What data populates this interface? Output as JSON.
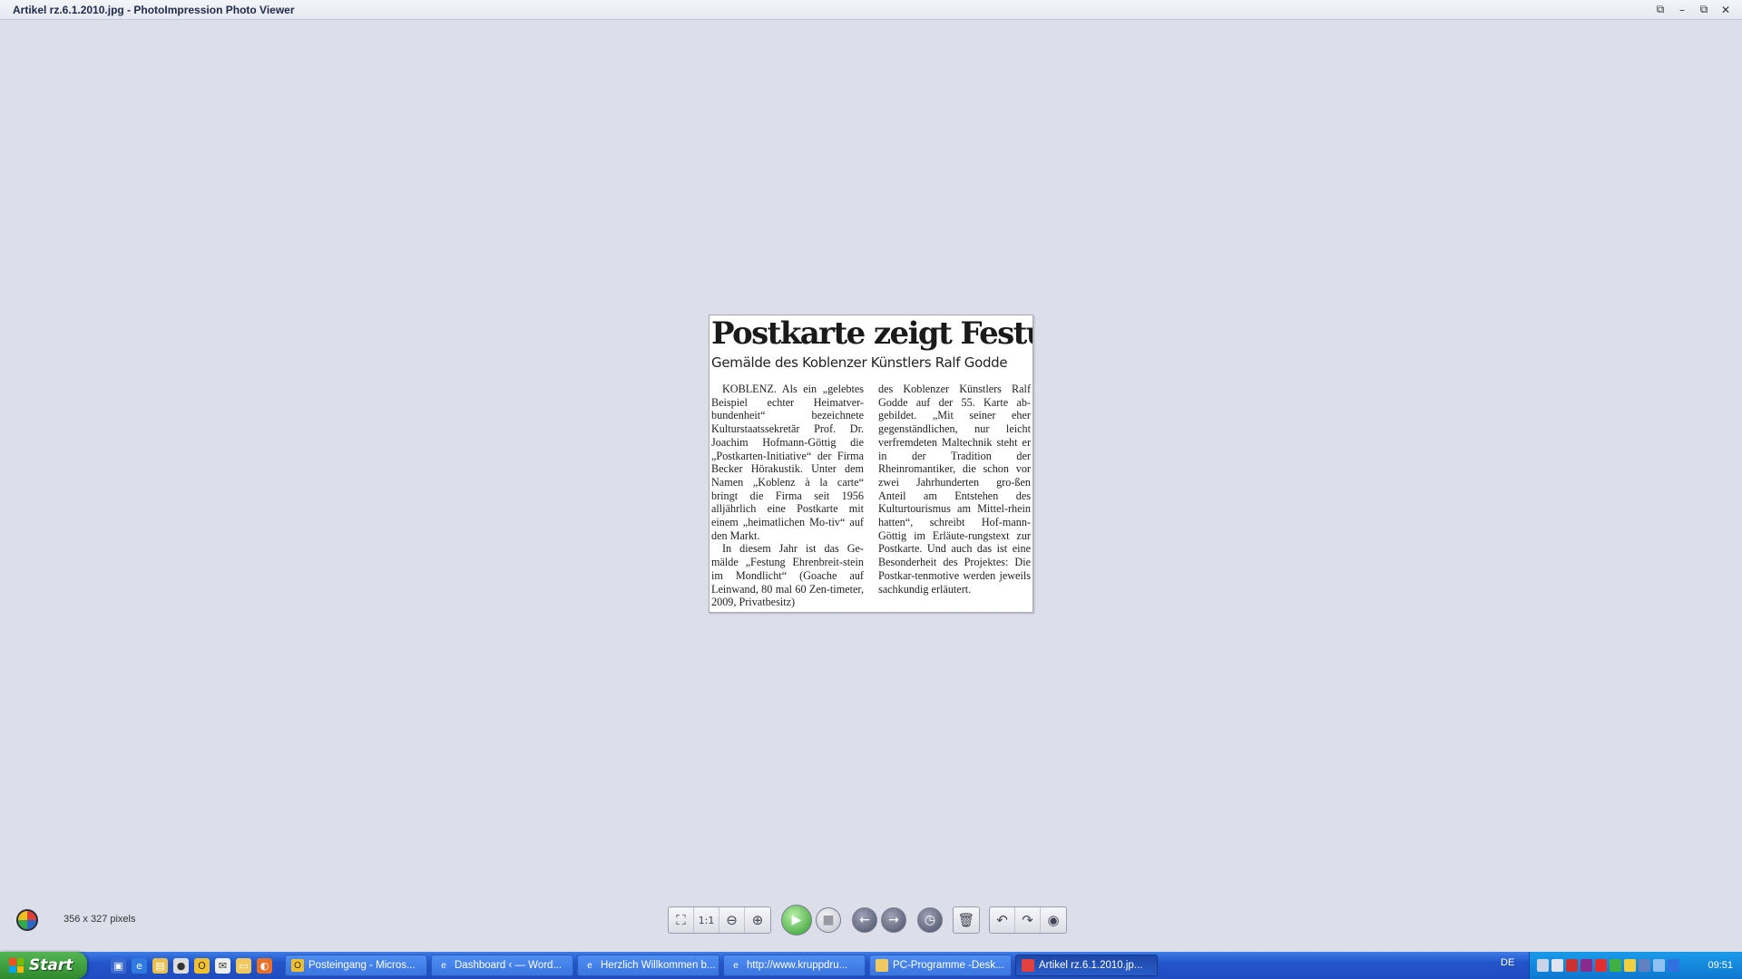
{
  "window": {
    "title": "Artikel rz.6.1.2010.jpg - PhotoImpression Photo Viewer",
    "buttons": [
      "⧉",
      "–",
      "⧉",
      "✕"
    ]
  },
  "article": {
    "headline": "Postkarte zeigt Festung",
    "subhead": "Gemälde des Koblenzer Künstlers Ralf Godde",
    "col1_p1": "KOBLENZ. Als ein „gelebtes Beispiel echter Heimatver-bundenheit“ bezeichnete Kulturstaatssekretär Prof. Dr. Joachim Hofmann-Göttig die „Postkarten-Initiative“ der Firma Becker Hörakustik. Unter dem Namen „Koblenz à la carte“ bringt die Firma seit 1956 alljährlich eine Postkarte mit einem „heimatlichen Mo-tiv“ auf den Markt.",
    "col1_p2": "In diesem Jahr ist das Ge-mälde „Festung Ehrenbreit-stein im Mondlicht“ (Goache auf Leinwand, 80 mal 60 Zen-timeter, 2009, Privatbesitz)",
    "col2": "des Koblenzer Künstlers Ralf Godde auf der 55. Karte ab-gebildet. „Mit seiner eher gegenständlichen, nur leicht verfremdeten Maltechnik steht er in der Tradition der Rheinromantiker, die schon vor zwei Jahrhunderten gro-ßen Anteil am Entstehen des Kulturtourismus am Mittel-rhein hatten“, schreibt Hof-mann-Göttig im Erläute-rungstext zur Postkarte. Und auch das ist eine Besonderheit des Projektes: Die Postkar-tenmotive werden jeweils sachkundig erläutert."
  },
  "status": {
    "dimensions": "356 x 327 pixels"
  },
  "toolbar": {
    "fit_icon": "fit-to-window-icon",
    "actual_size_label": "1:1",
    "zoom_out_icon": "zoom-out-icon",
    "zoom_in_icon": "zoom-in-icon",
    "play_icon": "play-icon",
    "stop_icon": "stop-icon",
    "prev_icon": "arrow-left-icon",
    "next_icon": "arrow-right-icon",
    "timer_icon": "timer-icon",
    "delete_icon": "trash-icon",
    "rotate_left_icon": "rotate-left-icon",
    "rotate_right_icon": "rotate-right-icon",
    "redeye_icon": "red-eye-icon"
  },
  "taskbar": {
    "start_label": "Start",
    "tasks": [
      "Posteingang - Micros...",
      "Dashboard ‹ — Word...",
      "Herzlich Willkommen b...",
      "http://www.kruppdru...",
      "PC-Programme -Desk...",
      "Artikel rz.6.1.2010.jp..."
    ],
    "language": "DE",
    "clock": "09:51"
  },
  "colors": {
    "viewer_bg": "#dcdeea",
    "taskbar_blue": "#2354c8",
    "start_green": "#3fa03f",
    "tray_blue": "#1a8ee0"
  }
}
